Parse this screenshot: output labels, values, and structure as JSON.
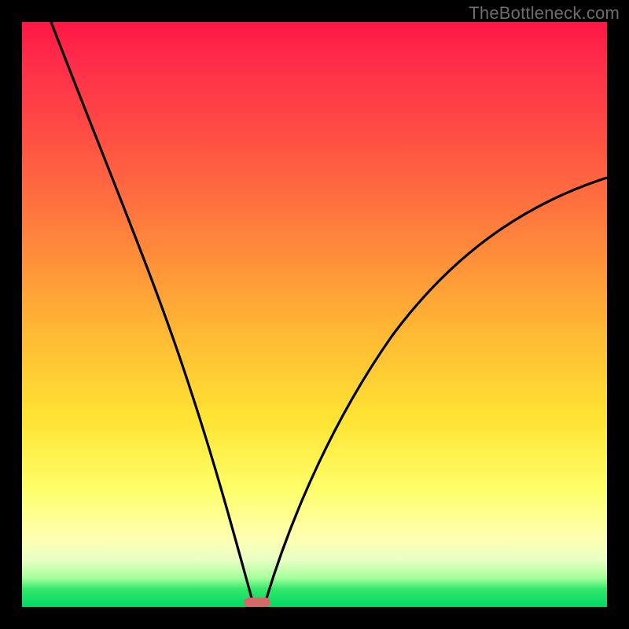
{
  "watermark": "TheBottleneck.com",
  "colors": {
    "frame": "#000000",
    "curve": "#000000",
    "marker": "#d36a6a",
    "gradient_top": "#ff1744",
    "gradient_mid": "#ffe433",
    "gradient_bottom": "#00d964"
  },
  "chart_data": {
    "type": "line",
    "title": "",
    "xlabel": "",
    "ylabel": "",
    "xlim": [
      0,
      100
    ],
    "ylim": [
      0,
      100
    ],
    "grid": false,
    "legend": false,
    "annotations": [
      {
        "kind": "marker",
        "x": 40,
        "y": 0,
        "shape": "pill",
        "color": "#d36a6a"
      }
    ],
    "series": [
      {
        "name": "left-branch",
        "note": "steep descending curve from top-left down to minimum near x≈40",
        "x": [
          5,
          11,
          17,
          23,
          28,
          32,
          35,
          37.5,
          39.0,
          40.0
        ],
        "values": [
          100,
          83,
          66,
          50,
          36,
          24,
          14,
          7.0,
          2.5,
          0.0
        ]
      },
      {
        "name": "right-branch",
        "note": "rising curve from minimum near x≈42 toward upper-right, shallower than left branch",
        "x": [
          42.0,
          44,
          47,
          51,
          56,
          62,
          69,
          77,
          86,
          95,
          100
        ],
        "values": [
          0.0,
          3,
          8,
          15,
          24,
          33,
          42,
          51,
          59,
          66,
          70
        ]
      }
    ]
  }
}
